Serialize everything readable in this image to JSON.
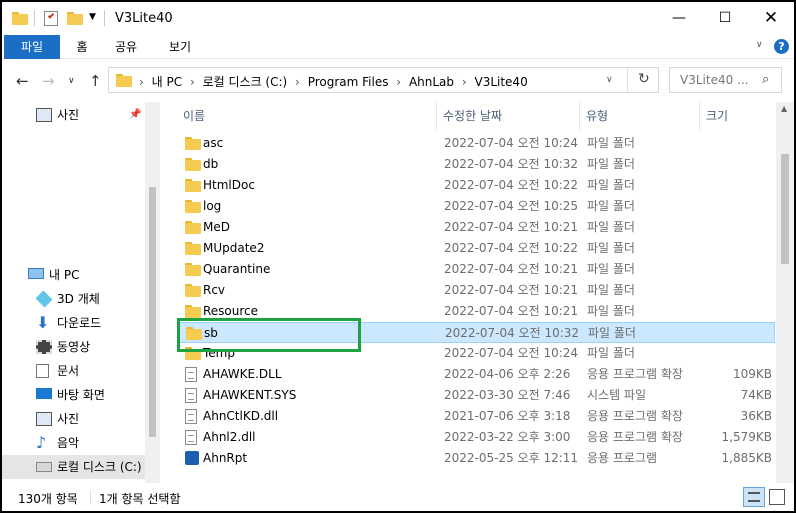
{
  "window": {
    "title": "V3Lite40"
  },
  "ribbon": {
    "tabs": [
      "파일",
      "홈",
      "공유",
      "보기"
    ]
  },
  "address": {
    "crumbs": [
      "내 PC",
      "로컬 디스크 (C:)",
      "Program Files",
      "AhnLab",
      "V3Lite40"
    ],
    "search_placeholder": "V3Lite40 ..."
  },
  "nav": {
    "quick_item": "사진",
    "items": [
      "내 PC",
      "3D 개체",
      "다운로드",
      "동영상",
      "문서",
      "바탕 화면",
      "사진",
      "음악",
      "로컬 디스크 (C:)"
    ]
  },
  "columns": [
    "이름",
    "수정한 날짜",
    "유형",
    "크기"
  ],
  "files": [
    {
      "name": "asc",
      "date": "2022-07-04 오전 10:24",
      "type": "파일 폴더",
      "size": "",
      "kind": "folder"
    },
    {
      "name": "db",
      "date": "2022-07-04 오전 10:32",
      "type": "파일 폴더",
      "size": "",
      "kind": "folder"
    },
    {
      "name": "HtmlDoc",
      "date": "2022-07-04 오전 10:22",
      "type": "파일 폴더",
      "size": "",
      "kind": "folder"
    },
    {
      "name": "log",
      "date": "2022-07-04 오전 10:25",
      "type": "파일 폴더",
      "size": "",
      "kind": "folder"
    },
    {
      "name": "MeD",
      "date": "2022-07-04 오전 10:21",
      "type": "파일 폴더",
      "size": "",
      "kind": "folder"
    },
    {
      "name": "MUpdate2",
      "date": "2022-07-04 오전 10:22",
      "type": "파일 폴더",
      "size": "",
      "kind": "folder"
    },
    {
      "name": "Quarantine",
      "date": "2022-07-04 오전 10:21",
      "type": "파일 폴더",
      "size": "",
      "kind": "folder"
    },
    {
      "name": "Rcv",
      "date": "2022-07-04 오전 10:21",
      "type": "파일 폴더",
      "size": "",
      "kind": "folder"
    },
    {
      "name": "Resource",
      "date": "2022-07-04 오전 10:21",
      "type": "파일 폴더",
      "size": "",
      "kind": "folder"
    },
    {
      "name": "sb",
      "date": "2022-07-04 오전 10:32",
      "type": "파일 폴더",
      "size": "",
      "kind": "folder",
      "selected": true
    },
    {
      "name": "Temp",
      "date": "2022-07-04 오전 10:24",
      "type": "파일 폴더",
      "size": "",
      "kind": "folder"
    },
    {
      "name": "AHAWKE.DLL",
      "date": "2022-04-06 오후 2:26",
      "type": "응용 프로그램 확장",
      "size": "109KB",
      "kind": "file"
    },
    {
      "name": "AHAWKENT.SYS",
      "date": "2022-03-30 오전 7:46",
      "type": "시스템 파일",
      "size": "74KB",
      "kind": "file"
    },
    {
      "name": "AhnCtlKD.dll",
      "date": "2021-07-06 오후 3:18",
      "type": "응용 프로그램 확장",
      "size": "36KB",
      "kind": "file"
    },
    {
      "name": "Ahnl2.dll",
      "date": "2022-03-22 오후 3:00",
      "type": "응용 프로그램 확장",
      "size": "1,579KB",
      "kind": "file"
    },
    {
      "name": "AhnRpt",
      "date": "2022-05-25 오후 12:11",
      "type": "응용 프로그램",
      "size": "1,885KB",
      "kind": "app"
    }
  ],
  "status": {
    "count": "130개 항목",
    "selected": "1개 항목 선택함"
  },
  "colors": {
    "accent": "#1a6ec6",
    "selection": "#cce8ff",
    "highlight": "#1fa342",
    "folder": "#f6cb51"
  }
}
